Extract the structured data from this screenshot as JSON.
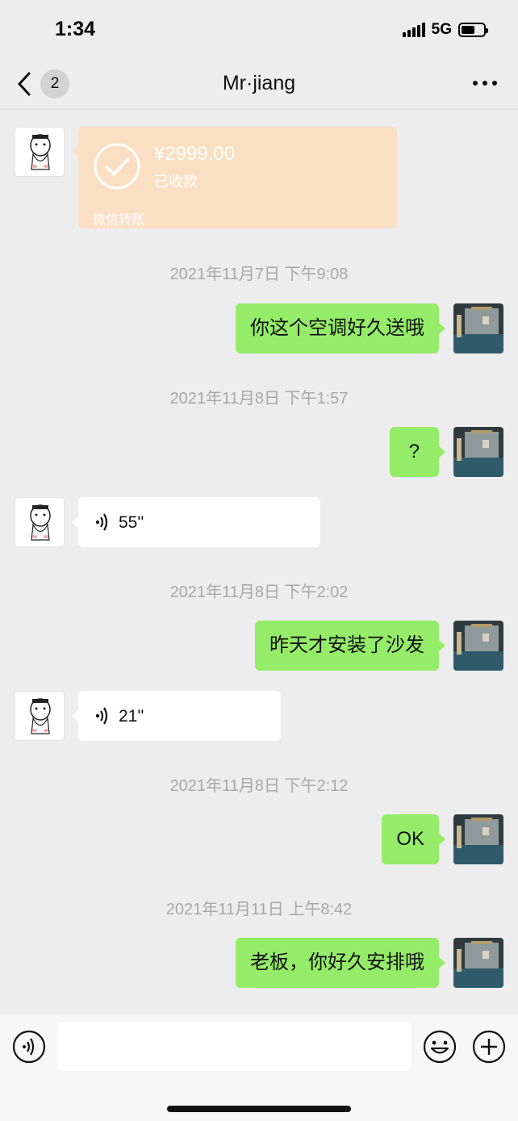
{
  "status_bar": {
    "time": "1:34",
    "network": "5G",
    "battery_level": 0.6
  },
  "nav": {
    "unread_count": "2",
    "title": "Mr·jiang",
    "icons": [
      "chevron-left-icon",
      "more-icon"
    ]
  },
  "transfer": {
    "amount": "¥2999.00",
    "status": "已收款",
    "label": "微信转账",
    "color": "#fbdfc3"
  },
  "messages": [
    {
      "type": "timestamp",
      "text": "2021年11月7日 下午9:08"
    },
    {
      "type": "text",
      "from": "me",
      "text": "你这个空调好久送哦"
    },
    {
      "type": "timestamp",
      "text": "2021年11月8日 下午1:57"
    },
    {
      "type": "text",
      "from": "me",
      "text": "?"
    },
    {
      "type": "voice",
      "from": "them",
      "duration": "55''"
    },
    {
      "type": "timestamp",
      "text": "2021年11月8日 下午2:02"
    },
    {
      "type": "text",
      "from": "me",
      "text": "昨天才安装了沙发"
    },
    {
      "type": "voice",
      "from": "them",
      "duration": "21''"
    },
    {
      "type": "timestamp",
      "text": "2021年11月8日 下午2:12"
    },
    {
      "type": "text",
      "from": "me",
      "text": "OK"
    },
    {
      "type": "timestamp",
      "text": "2021年11月11日 上午8:42"
    },
    {
      "type": "text",
      "from": "me",
      "text": "老板，你好久安排哦"
    }
  ],
  "input_bar": {
    "placeholder": "",
    "icons": [
      "voice-input-icon",
      "emoji-icon",
      "plus-icon"
    ]
  },
  "colors": {
    "background": "#ededed",
    "outgoing_bubble": "#95ec69",
    "incoming_bubble": "#ffffff",
    "timestamp_text": "#a8a8a8"
  }
}
